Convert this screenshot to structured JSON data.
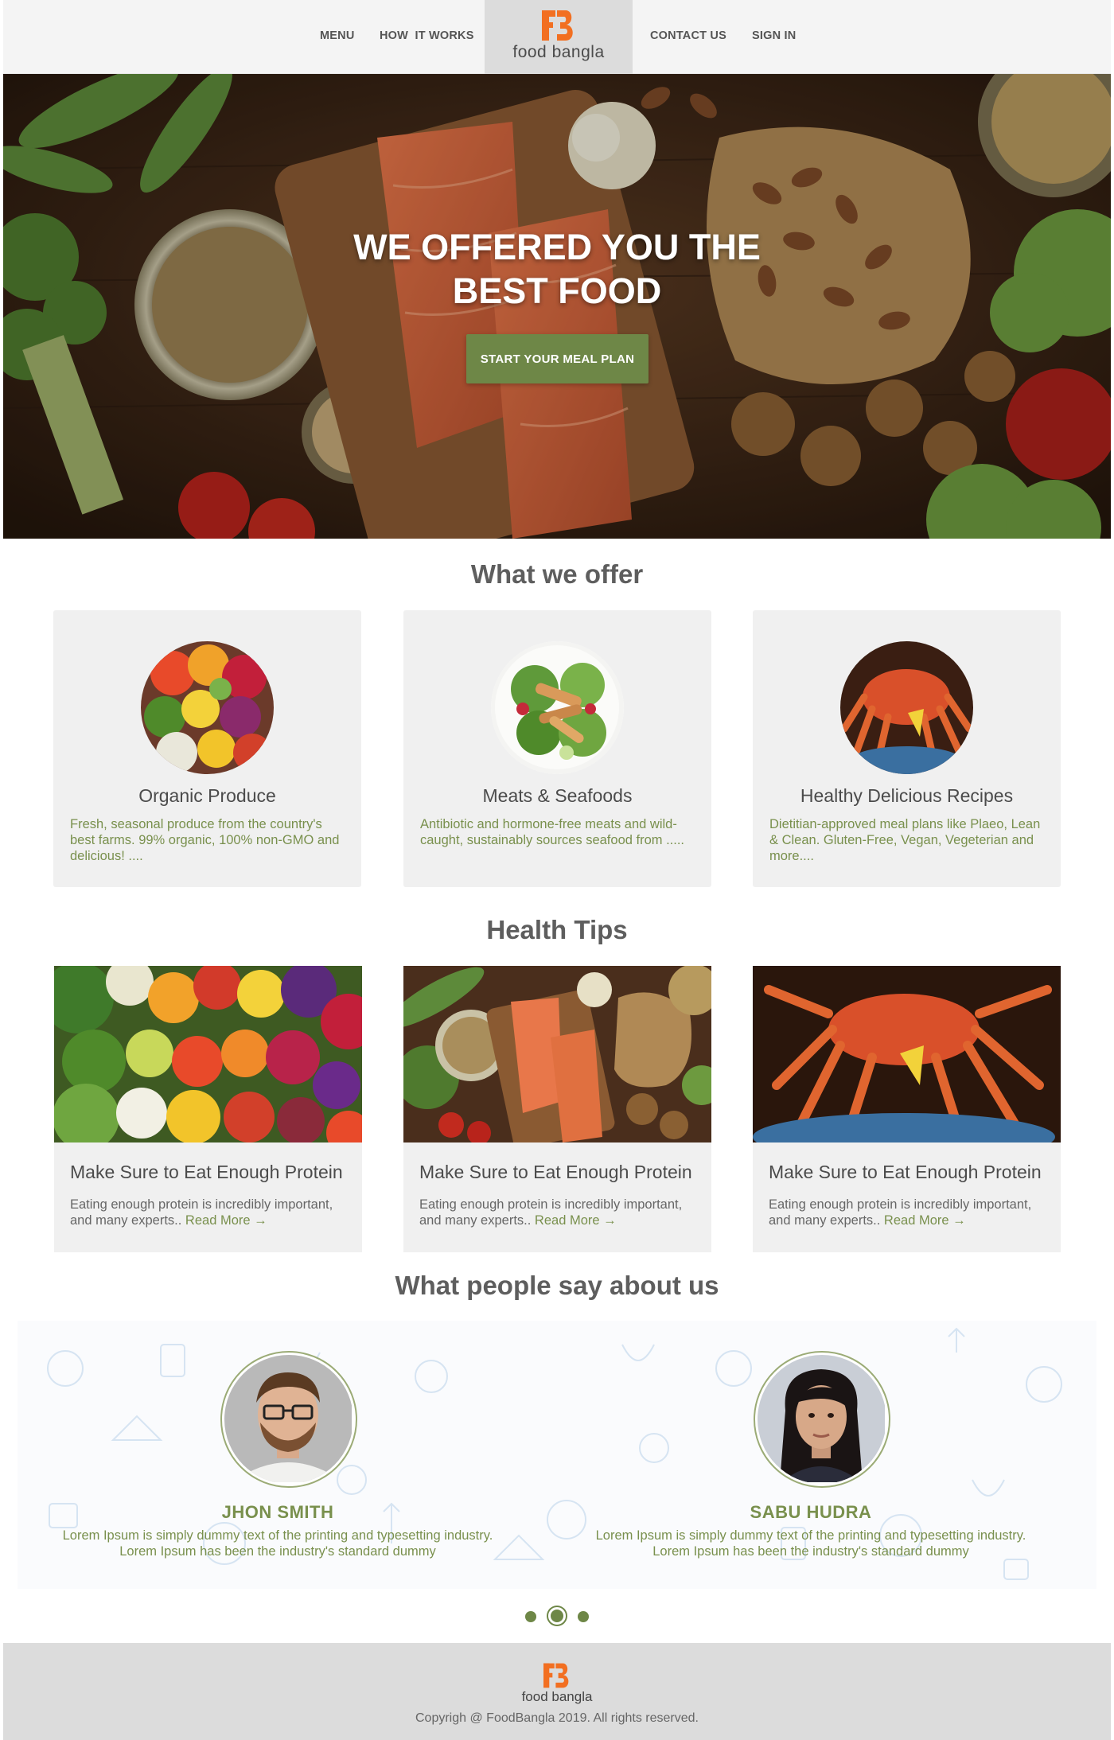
{
  "nav": {
    "menu": "MENU",
    "how_it_works": "HOW  IT WORKS",
    "contact_us": "CONTACT US",
    "sign_in": "SIGN IN"
  },
  "brand": {
    "name": "food bangla",
    "primary_color": "#f26f21",
    "accent_color": "#6e8747"
  },
  "hero": {
    "title_line1": "WE OFFERED YOU THE",
    "title_line2": "BEST FOOD",
    "cta": "START YOUR MEAL PLAN"
  },
  "offers": {
    "title": "What we offer",
    "items": [
      {
        "title": "Organic Produce",
        "description": "Fresh, seasonal produce from the country's best farms. 99% organic, 100% non-GMO and delicious! ....",
        "icon": "vegetables-image"
      },
      {
        "title": "Meats & Seafoods",
        "description": "Antibiotic and hormone-free meats and wild-caught, sustainably sources seafood from .....",
        "icon": "salad-image"
      },
      {
        "title": "Healthy Delicious Recipes",
        "description": "Dietitian-approved meal plans like Plaeo, Lean & Clean. Gluten-Free, Vegan, Vegeterian and more....",
        "icon": "crab-image"
      }
    ]
  },
  "tips": {
    "title": "Health Tips",
    "items": [
      {
        "title": "Make Sure to Eat Enough Protein",
        "description": "Eating enough protein is incredibly important, and many experts.. ",
        "read_more": "Read More →"
      },
      {
        "title": "Make Sure to Eat Enough Protein",
        "description": "Eating enough protein is incredibly important, and many experts.. ",
        "read_more": "Read More →"
      },
      {
        "title": "Make Sure to Eat Enough Protein",
        "description": "Eating enough protein is incredibly important, and many experts.. ",
        "read_more": "Read More →"
      }
    ]
  },
  "testimonials": {
    "title": "What people say about us",
    "items": [
      {
        "name": "JHON SMITH",
        "line1": "Lorem Ipsum is simply dummy text of the printing and typesetting industry.",
        "line2": "Lorem Ipsum has been the industry's standard dummy"
      },
      {
        "name": "SABU HUDRA",
        "line1": "Lorem Ipsum is simply dummy text of the printing and typesetting industry.",
        "line2": "Lorem Ipsum has been the industry's standard dummy"
      }
    ],
    "active_slide": 2,
    "slide_count": 3
  },
  "footer": {
    "brand": "food bangla",
    "copyright": "Copyrigh @ FoodBangla 2019. All rights reserved."
  }
}
